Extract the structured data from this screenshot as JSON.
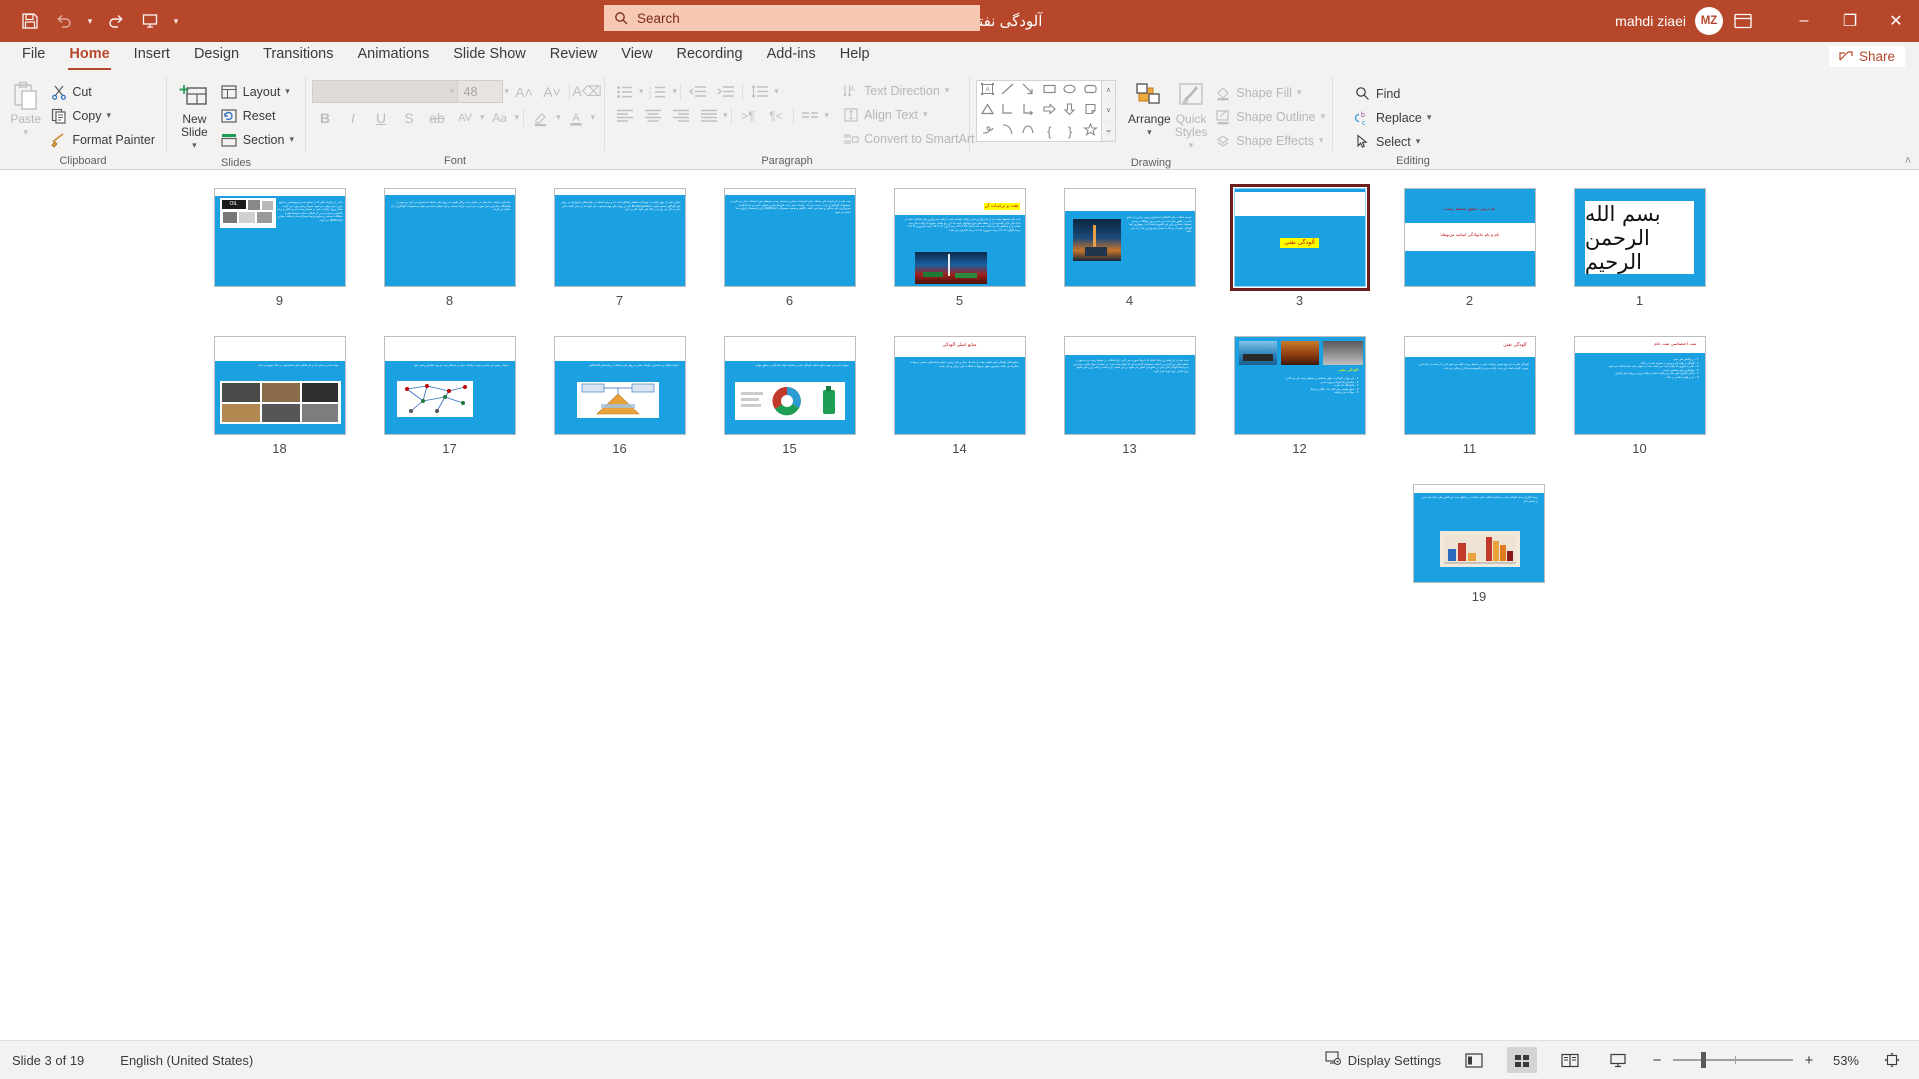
{
  "titlebar": {
    "document_title": "آلودگی نفتی  -  PowerPoint",
    "quick_access": [
      {
        "name": "save",
        "icon": "save-icon"
      },
      {
        "name": "undo",
        "icon": "undo-icon"
      },
      {
        "name": "redo",
        "icon": "redo-icon"
      },
      {
        "name": "start-from-beginning",
        "icon": "slideshow-icon"
      },
      {
        "name": "customize-qat",
        "icon": "chevron-down-icon"
      }
    ],
    "search_placeholder": "Search",
    "user_name": "mahdi ziaei",
    "user_initials": "MZ",
    "window": {
      "minimize": "–",
      "maximize": "❐",
      "close": "✕"
    }
  },
  "tabs": [
    {
      "label": "File",
      "active": false
    },
    {
      "label": "Home",
      "active": true
    },
    {
      "label": "Insert",
      "active": false
    },
    {
      "label": "Design",
      "active": false
    },
    {
      "label": "Transitions",
      "active": false
    },
    {
      "label": "Animations",
      "active": false
    },
    {
      "label": "Slide Show",
      "active": false
    },
    {
      "label": "Review",
      "active": false
    },
    {
      "label": "View",
      "active": false
    },
    {
      "label": "Recording",
      "active": false
    },
    {
      "label": "Add-ins",
      "active": false
    },
    {
      "label": "Help",
      "active": false
    }
  ],
  "share_label": "Share",
  "ribbon": {
    "clipboard": {
      "title": "Clipboard",
      "paste": "Paste",
      "items": [
        "Cut",
        "Copy",
        "Format Painter"
      ]
    },
    "slides": {
      "title": "Slides",
      "new_slide": "New Slide",
      "items": [
        "Layout",
        "Reset",
        "Section"
      ]
    },
    "font": {
      "title": "Font",
      "font_name": "",
      "font_size": "48"
    },
    "paragraph": {
      "title": "Paragraph",
      "items": [
        "Text Direction",
        "Align Text",
        "Convert to SmartArt"
      ]
    },
    "drawing": {
      "title": "Drawing",
      "arrange": "Arrange",
      "quick_styles": "Quick Styles",
      "items": [
        "Shape Fill",
        "Shape Outline",
        "Shape Effects"
      ]
    },
    "editing": {
      "title": "Editing",
      "items": [
        "Find",
        "Replace",
        "Select"
      ]
    }
  },
  "slides": [
    {
      "number": "9",
      "row": 0,
      "type": "text-image-left",
      "title": "",
      "body": "مبلدر از ترکیبات کلی که از صنایع نفت و پتروشیمی و صنایع پایین دستی تولید می شود معمولا زیستی وارد می گردند مقدار ورود ترکیبات نفتی به محیط ‌زیست آبی و خاکی و ذرات پالایشی و معدنی و در اثر فعالیت صنعت توسط لوله و مشکلات صنعتی و صنایع مرتبط بسیار است و عملیات حفاری (Refinery) می گردد."
    },
    {
      "number": "8",
      "row": 0,
      "type": "text",
      "title": "",
      "body": "مقدماتی ترکیبات خام نفتی در مخازن نفت و گاز طبیعی به روش های مختلف استخراج می گردد و سپس در پالایشگاه جداسازی اجزا صورت می پذیرد. فرآیند تصفیه بر پایه تقطیر انجام می شود و محصولات گوناگون از آن حاصل می گردد."
    },
    {
      "number": "7",
      "row": 0,
      "type": "text",
      "title": "",
      "body": "مخازن نفتی از نوع ترکیبات با پیچیدگی مختلفی تشکیل شده اند و برای استفاده در فرآیندهای متنوع باید به روش های گوناگون تصفیه شوند. Biodegradation یکی از روش های مهم محسوب می شود که در حذف آلاینده های نفتی به کار می رود و در خاک های آلوده کاربرد دارد."
    },
    {
      "number": "6",
      "row": 0,
      "type": "text",
      "title": "",
      "body": "نفت خام در اثر فرآیند های مختلف نفتی تاسیسات مخازن و تصفیه زیست محیطی مورد استفاده قرار می گیرد و محصولات گوناگون از آن به دست می آید. ترکیبات نفتی بنا به شرایط مخزن متفاوت است و عمدتا شامل هیدروکربن های سنگین و سبک می باشد. پالایش و تصفیه محصولات (Refinery) برای استحصال فرآورده ها انجام می شود."
    },
    {
      "number": "5",
      "row": 0,
      "type": "text-image",
      "title": "نفت و ترکیبات آن",
      "body": "نفت خام مخلوط پیچیده ای از هیدروکربن ها و ترکیبات وابسته است. ترکیب هیدروکربن های تشکیل دهنده از مازاد های بالای گسترده ای از نقطه نظر تنوع مولکولی است که این رنج شامل متنوع تا ترکیبات های چند هسته ای و اسفالتن ها می باشد. نفت خام شامل 84 تا 87 درصد کربن، 11 تا 14 درصد هیدروژن، 0 تا 5 درصد گوگرد، 0 تا 1 درصد نیتروژن، 0 تا 1 درصد اکسیژن می باشد."
    },
    {
      "number": "4",
      "row": 0,
      "type": "text-image-left",
      "title": "",
      "body": "توسعه فعالیت های اکتشافی استخراج و بهره برداری از منابع نفتی در کشور های نفت خیز سبب بروز مشکلات زیست محیطی متعددی برای این کشورها شده که از مهمترین آنها آلودگی منابع آب و خاک با مقدار هیدروکربن ها در آب می باشد."
    },
    {
      "number": "3",
      "row": 0,
      "type": "title-slide",
      "title": "آلودگی نفتی",
      "body": "",
      "selected": true
    },
    {
      "number": "2",
      "row": 0,
      "type": "course-title",
      "title": "نام درس: حقوق محیط زیست",
      "body": "نام و نام خانوادگی اساتید مربوطه:"
    },
    {
      "number": "1",
      "row": 0,
      "type": "bismillah",
      "title": "بسم الله الرحمن الرحیم",
      "body": ""
    },
    {
      "number": "18",
      "row": 1,
      "type": "image-grid",
      "title": "",
      "body": "مواد معدنی و نفتی که بر اثر فعالیت های استخراجی در خاک تجمع می یابند"
    },
    {
      "number": "17",
      "row": 1,
      "type": "diagram",
      "title": "",
      "body": "نمودار زنجیره ای تبدیل و تجزیه ترکیبات نفتی در محیط زیست و روند پالایش زیستی آنها"
    },
    {
      "number": "16",
      "row": 1,
      "type": "diagram2",
      "title": "",
      "body": "فرآیند تفکیک و جداسازی ترکیبات نفتی به روش های مختلف در واحدهای پالایشگاهی"
    },
    {
      "number": "15",
      "row": 1,
      "type": "chart",
      "title": "",
      "body": "نمودار دایره ای سهم منابع مختلف آلودگی نفتی و مقایسه آنها با یکدیگر در سطح جهانی"
    },
    {
      "number": "14",
      "row": 1,
      "type": "text",
      "title": "منابع اصلی آلودگی",
      "body": "منابع اصلی آلودگی نفتی شامل نشت از چاه ها، حمل و نقل دریایی، تخلیه پسماندهای صنعتی و حوادث تانکرها می باشد. بیشترین سهم مربوط به فعالیت های دریایی و بنادر است."
    },
    {
      "number": "13",
      "row": 1,
      "type": "text",
      "title": "",
      "body": "نفت خام در اثر نشتی و رخداد اتفاق ها با مواد صورت می گیرد. این اتفاقات در محیط زیست و به صورت منظم ایجاد می گردد و بر اساس تحقیقات گسترده ای که انجام شده است، در نتیجه از مواد ناشی برخی این به و ایجاد آلودگی های جدی در منابع آبی کشور می شود. بر این اساس لازم است برنامه ریزی های دقیقی برای کنترل مورد توجه قرار گیرد."
    },
    {
      "number": "12",
      "row": 1,
      "type": "image-row",
      "title": "آلودگی نفتی",
      "body": "1 - این نوع از آلودگی به طور مستقیم بر محیط زیست اثر می گذارد.\n2 - استانداردها، قواعد و بهره مندی.\n3 - پالایشگاه ها، نشت.\n4 - منابع طبیعی مثل تالاب ها، جنگل و دریاها.\n5 - حوادث خیر مترقبه."
    },
    {
      "number": "11",
      "row": 1,
      "type": "text",
      "title": "آلودگی نفتی",
      "body": "آلودگی نفتی به هر نوع حضور ترکیبات نفتی در محیط زیست گفته می شود که بر اثر نشت یا رها سازی صورت گرفته باشد. این پدیده اثرات جدی بر اکوسیستم ها دارد و باقی می ماند."
    },
    {
      "number": "10",
      "row": 1,
      "type": "text",
      "title": "نفت اختصاصی نفت خام",
      "body": "1 - بر واکنش های نفتی.\n2 - آلودگی و تولید فاز و چربی به همراه نشت در خاک.\n3 - نفتی به طوری که وقتی نفت می نامند، نفت به عنوان ماده خام شناخته می شود.\n4 - نوع فلزی های مشخص است.\n5 - مقدار فراوان های نفتی و ترکیبات اصلی ترکیبات ویژه و روش های پالایش.\n6 - آب و هوا و عناصر در خاک."
    },
    {
      "number": "19",
      "row": 2,
      "type": "chart-image",
      "title": "",
      "body": "درصد گزارش شده آلودگی نفتی و مقایسه فعالیت های مختلف در مناطق نفت خیز کشور طی سال های اخیر بر اساس آمار"
    }
  ],
  "statusbar": {
    "slide_indicator": "Slide 3 of 19",
    "language": "English (United States)",
    "display_settings": "Display Settings",
    "views": [
      {
        "name": "normal-view",
        "active": false
      },
      {
        "name": "slide-sorter-view",
        "active": true
      },
      {
        "name": "reading-view",
        "active": false
      },
      {
        "name": "slideshow-view",
        "active": false
      }
    ],
    "zoom_out": "−",
    "zoom_in": "+",
    "zoom_level": "53%",
    "fit_to_window": "fit-icon"
  }
}
